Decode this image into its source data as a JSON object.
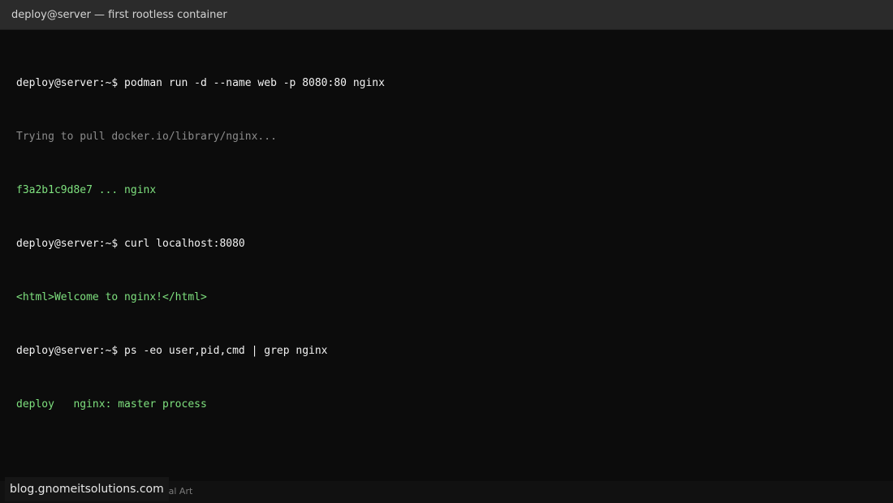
{
  "window": {
    "title": "deploy@server — first rootless container"
  },
  "terminal": {
    "lines": [
      {
        "text": "deploy@server:~$ podman run -d --name web -p 8080:80 nginx",
        "kind": "command"
      },
      {
        "text": "Trying to pull docker.io/library/nginx...",
        "kind": "output-muted"
      },
      {
        "text": "f3a2b1c9d8e7 ... nginx",
        "kind": "output-success"
      },
      {
        "text": "deploy@server:~$ curl localhost:8080",
        "kind": "command"
      },
      {
        "text": "<html>Welcome to nginx!</html>",
        "kind": "output-success"
      },
      {
        "text": "deploy@server:~$ ps -eo user,pid,cmd | grep nginx",
        "kind": "command"
      },
      {
        "text": "deploy   nginx: master process",
        "kind": "output-success"
      }
    ]
  },
  "statusbar": {
    "text": "Tutorial Art"
  },
  "watermark": {
    "text": "blog.gnomeitsolutions.com"
  },
  "colors": {
    "background": "#0c0c0c",
    "titlebar": "#2b2b2b",
    "command": "#f2f2f2",
    "muted": "#8c8c8c",
    "success": "#7ee07e"
  }
}
